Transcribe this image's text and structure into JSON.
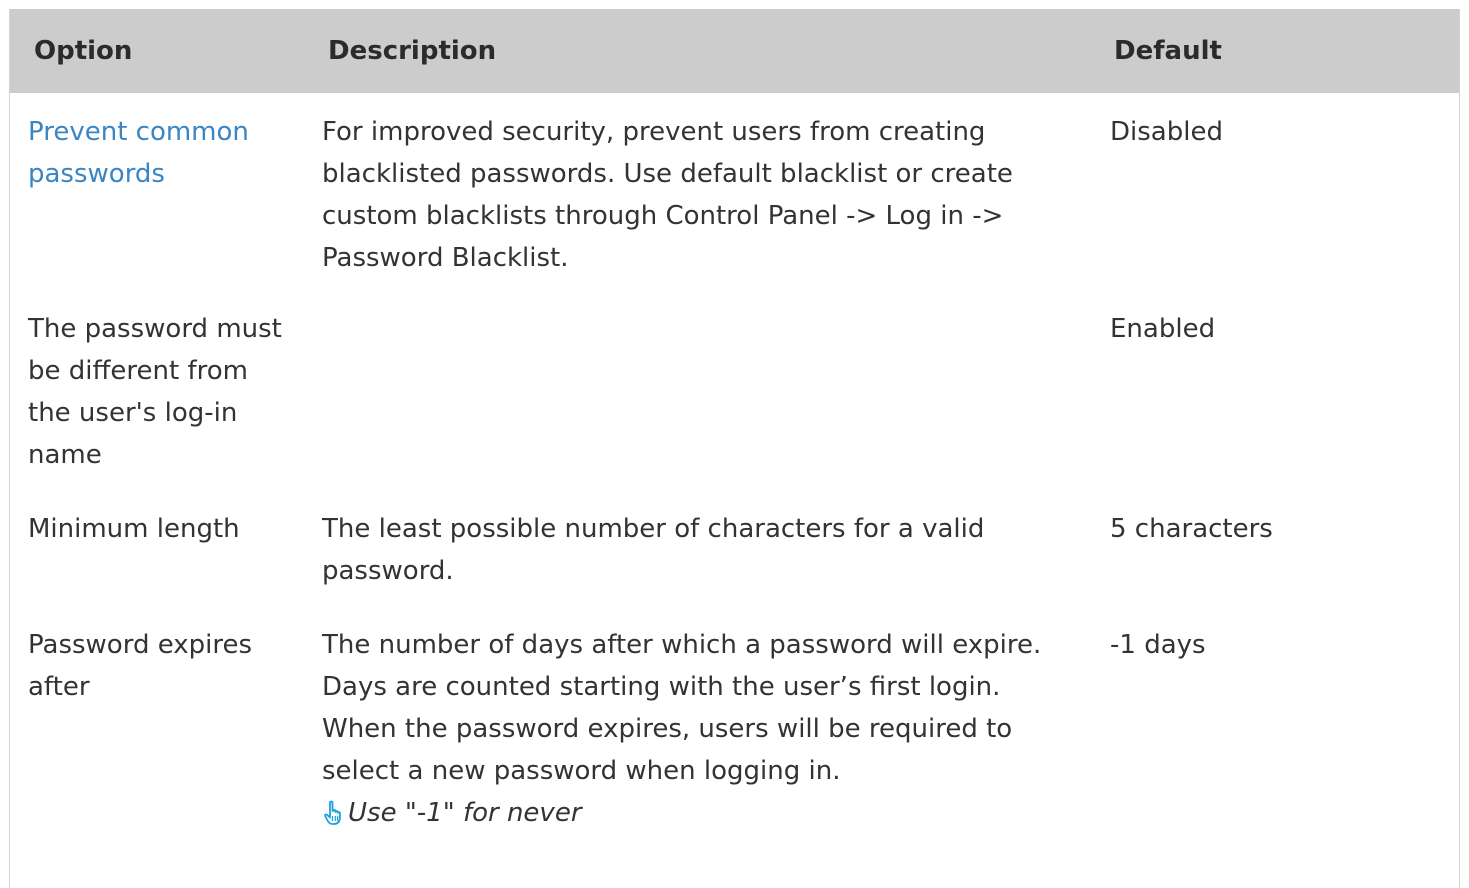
{
  "table": {
    "headers": {
      "option": "Option",
      "description": "Description",
      "default": "Default"
    },
    "rows": [
      {
        "option": "Prevent common passwords",
        "option_is_link": true,
        "description": "For improved security, prevent users from creating blacklisted passwords. Use default blacklist or create custom blacklists through Control Panel -> Log in -> Password Blacklist.",
        "default": "Disabled"
      },
      {
        "option": "The password must be different from the user's log-in name",
        "description": "",
        "default": "Enabled"
      },
      {
        "option": "Minimum length",
        "description": "The least possible number of characters for a valid password.",
        "default": "5 characters"
      },
      {
        "option": "Password expires after",
        "description": "The number of days after which a password will expire. Days are counted starting with the user’s first login. When the password expires, users will be required to select a new password when logging in.",
        "note": "Use \"-1\" for never",
        "note_icon": "pointing-hand-icon",
        "default": "-1 days"
      }
    ]
  },
  "colors": {
    "header_bg": "#cccccc",
    "link": "#3a86c4",
    "text": "#333333",
    "icon": "#1aa3e0"
  }
}
